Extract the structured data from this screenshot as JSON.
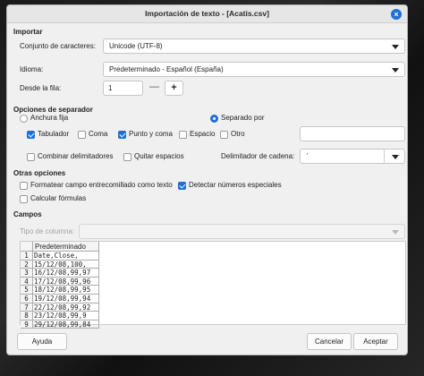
{
  "window": {
    "title": "Importación de texto - [Acatis.csv]"
  },
  "import": {
    "section": "Importar",
    "charset_label": "Conjunto de caracteres:",
    "charset_value": "Unicode (UTF-8)",
    "language_label": "Idioma:",
    "language_value": "Predeterminado - Español (España)",
    "from_row_label": "Desde la fila:",
    "from_row_value": "1",
    "minus": "—",
    "plus": "+"
  },
  "separator": {
    "section": "Opciones de separador",
    "fixed_width": "Anchura fija",
    "separated_by": "Separado por",
    "tab": "Tabulador",
    "comma": "Coma",
    "semicolon": "Punto y coma",
    "space": "Espacio",
    "other": "Otro",
    "merge_delimiters": "Combinar delimitadores",
    "trim_spaces": "Quitar espacios",
    "string_delimiter_label": "Delimitador de cadena:",
    "string_delimiter_value": "'"
  },
  "other_options": {
    "section": "Otras opciones",
    "format_quoted": "Formatear campo entrecomillado como texto",
    "detect_special": "Detectar números especiales",
    "evaluate_formulas": "Calcular fórmulas"
  },
  "fields": {
    "section": "Campos",
    "column_type_label": "Tipo de columna:",
    "column_header": "Predeterminado",
    "rows": [
      {
        "num": "1",
        "text": "Date,Close,"
      },
      {
        "num": "2",
        "text": "15/12/08,100,"
      },
      {
        "num": "3",
        "text": "16/12/08,99,97"
      },
      {
        "num": "4",
        "text": "17/12/08,99,96"
      },
      {
        "num": "5",
        "text": "18/12/08,99,95"
      },
      {
        "num": "6",
        "text": "19/12/08,99,94"
      },
      {
        "num": "7",
        "text": "22/12/08,99,92"
      },
      {
        "num": "8",
        "text": "23/12/08,99,9"
      },
      {
        "num": "9",
        "text": "29/12/08,99,84"
      }
    ]
  },
  "buttons": {
    "help": "Ayuda",
    "cancel": "Cancelar",
    "accept": "Aceptar"
  },
  "colors": {
    "accent": "#1e6fd9"
  }
}
